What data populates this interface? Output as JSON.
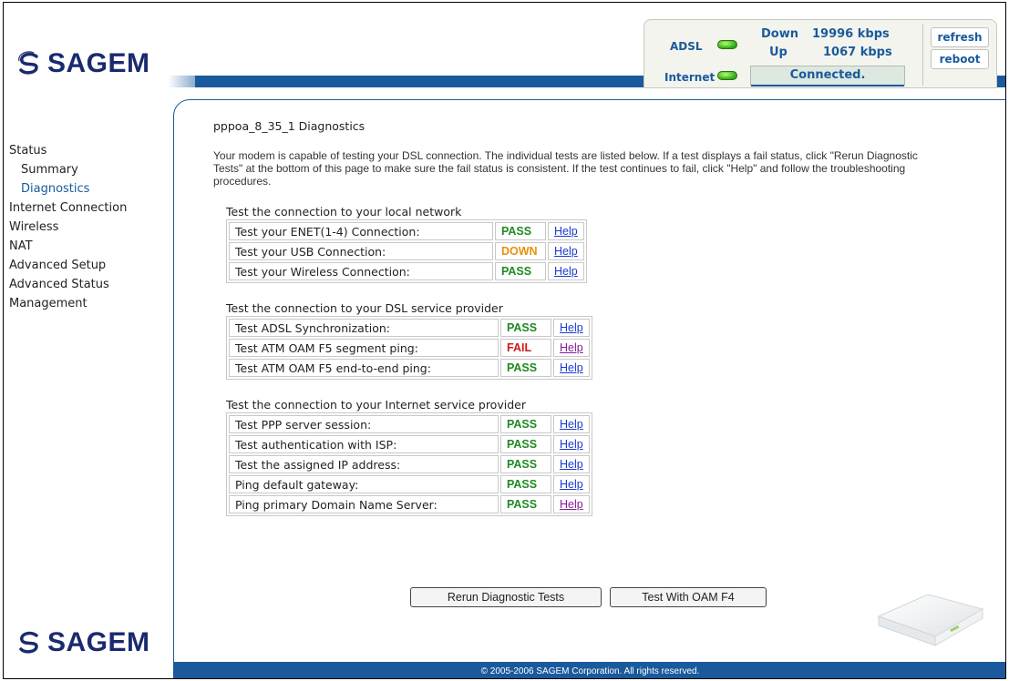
{
  "brand": {
    "name": "SAGEM",
    "accent": "#1a5a9c",
    "logo_color": "#1a2a6e"
  },
  "status_panel": {
    "adsl_label": "ADSL",
    "internet_label": "Internet",
    "down_label": "Down",
    "down_value": "19996 kbps",
    "up_label": "Up",
    "up_value": "1067 kbps",
    "connection_status": "Connected.",
    "refresh_label": "refresh",
    "reboot_label": "reboot"
  },
  "sidebar": {
    "items": [
      {
        "label": "Status",
        "level": 0
      },
      {
        "label": "Summary",
        "level": 1
      },
      {
        "label": "Diagnostics",
        "level": 1,
        "active": true
      },
      {
        "label": "Internet Connection",
        "level": 0
      },
      {
        "label": "Wireless",
        "level": 0
      },
      {
        "label": "NAT",
        "level": 0
      },
      {
        "label": "Advanced Setup",
        "level": 0
      },
      {
        "label": "Advanced Status",
        "level": 0
      },
      {
        "label": "Management",
        "level": 0
      }
    ]
  },
  "main": {
    "title": "pppoa_8_35_1 Diagnostics",
    "intro": "Your modem is capable of testing your DSL connection. The individual tests are listed below. If a test displays a fail status, click \"Rerun Diagnostic Tests\" at the bottom of this page to make sure the fail status is consistent. If the test continues to fail, click \"Help\" and follow the troubleshooting procedures.",
    "sections": [
      {
        "title": "Test the connection to your local network",
        "rows": [
          {
            "name": "Test your ENET(1-4) Connection:",
            "status": "PASS",
            "help": "Help"
          },
          {
            "name": "Test your USB Connection:",
            "status": "DOWN",
            "help": "Help"
          },
          {
            "name": "Test your Wireless Connection:",
            "status": "PASS",
            "help": "Help"
          }
        ]
      },
      {
        "title": "Test the connection to your DSL service provider",
        "rows": [
          {
            "name": "Test ADSL Synchronization:",
            "status": "PASS",
            "help": "Help"
          },
          {
            "name": "Test ATM OAM F5 segment ping:",
            "status": "FAIL",
            "help": "Help"
          },
          {
            "name": "Test ATM OAM F5 end-to-end ping:",
            "status": "PASS",
            "help": "Help"
          }
        ]
      },
      {
        "title": "Test the connection to your Internet service provider",
        "rows": [
          {
            "name": "Test PPP server session:",
            "status": "PASS",
            "help": "Help"
          },
          {
            "name": "Test authentication with ISP:",
            "status": "PASS",
            "help": "Help"
          },
          {
            "name": "Test the assigned IP address:",
            "status": "PASS",
            "help": "Help"
          },
          {
            "name": "Ping default gateway:",
            "status": "PASS",
            "help": "Help"
          },
          {
            "name": "Ping primary Domain Name Server:",
            "status": "PASS",
            "help": "Help"
          }
        ]
      }
    ],
    "rerun_button": "Rerun Diagnostic Tests",
    "oam_button": "Test With OAM F4"
  },
  "status_colors": {
    "PASS": "#1f8a1f",
    "DOWN": "#e8900c",
    "FAIL": "#d01818"
  },
  "footer": {
    "copyright": "© 2005-2006 SAGEM Corporation. All rights reserved."
  }
}
